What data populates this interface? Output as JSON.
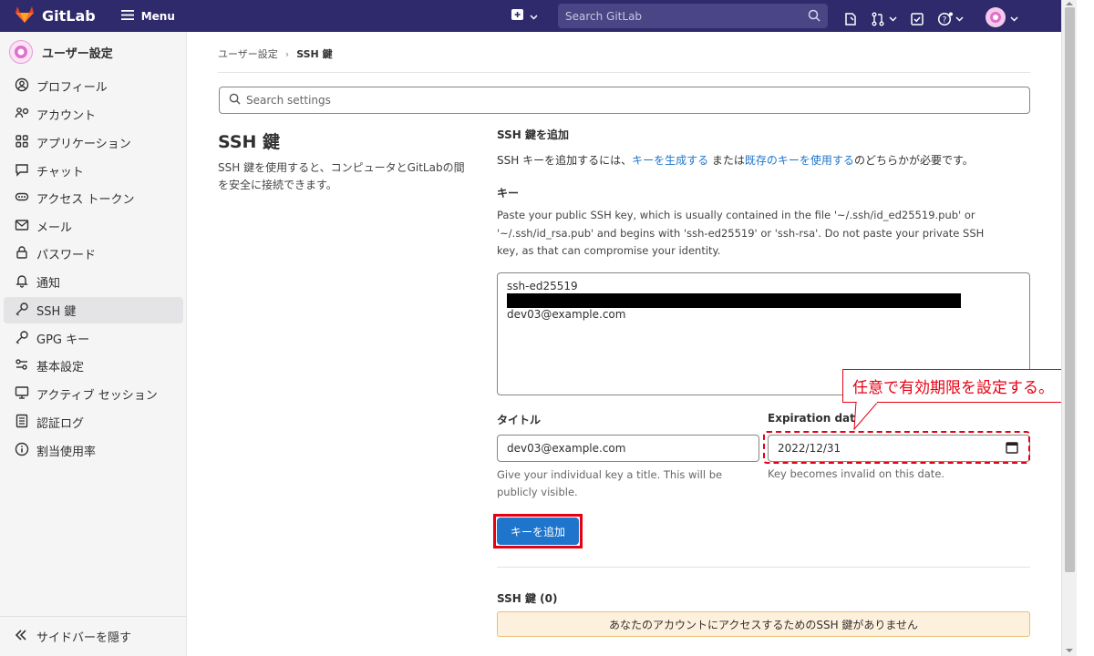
{
  "app": {
    "name": "GitLab",
    "menu_label": "Menu",
    "search_placeholder": "Search GitLab"
  },
  "sidebar": {
    "title": "ユーザー設定",
    "items": [
      {
        "label": "プロフィール",
        "icon": "profile-icon"
      },
      {
        "label": "アカウント",
        "icon": "account-icon"
      },
      {
        "label": "アプリケーション",
        "icon": "applications-icon"
      },
      {
        "label": "チャット",
        "icon": "chat-icon"
      },
      {
        "label": "アクセス トークン",
        "icon": "token-icon"
      },
      {
        "label": "メール",
        "icon": "mail-icon"
      },
      {
        "label": "パスワード",
        "icon": "lock-icon"
      },
      {
        "label": "通知",
        "icon": "bell-icon"
      },
      {
        "label": "SSH 鍵",
        "icon": "key-icon",
        "active": true
      },
      {
        "label": "GPG キー",
        "icon": "key-icon"
      },
      {
        "label": "基本設定",
        "icon": "preferences-icon"
      },
      {
        "label": "アクティブ セッション",
        "icon": "monitor-icon"
      },
      {
        "label": "認証ログ",
        "icon": "log-icon"
      },
      {
        "label": "割当使用率",
        "icon": "quota-icon"
      }
    ],
    "collapse_label": "サイドバーを隠す"
  },
  "breadcrumb": {
    "parent": "ユーザー設定",
    "current": "SSH 鍵"
  },
  "settings_search": {
    "placeholder": "Search settings"
  },
  "section": {
    "title": "SSH 鍵",
    "description": "SSH 鍵を使用すると、コンピュータとGitLabの間を安全に接続できます。"
  },
  "form": {
    "heading": "SSH 鍵を追加",
    "intro_prefix": "SSH キーを追加するには、",
    "intro_link1": "キーを生成する",
    "intro_mid": " または",
    "intro_link2": "既存のキーを使用する",
    "intro_suffix": "のどちらかが必要です。",
    "key_label": "キー",
    "key_help": "Paste your public SSH key, which is usually contained in the file '~/.ssh/id_ed25519.pub' or '~/.ssh/id_rsa.pub' and begins with 'ssh-ed25519' or 'ssh-rsa'. Do not paste your private SSH key, as that can compromise your identity.",
    "key_line1": "ssh-ed25519",
    "key_line3": "dev03@example.com",
    "title_label": "タイトル",
    "title_value": "dev03@example.com",
    "title_help": "Give your individual key a title. This will be publicly visible.",
    "expiration_label": "Expiration date",
    "expiration_value": "2022/12/31",
    "expiration_help": "Key becomes invalid on this date.",
    "submit_label": "キーを追加"
  },
  "keys_list": {
    "heading": "SSH 鍵 (0)",
    "empty_message": "あなたのアカウントにアクセスするためのSSH 鍵がありません"
  },
  "annotation": {
    "callout_text": "任意で有効期限を設定する。",
    "color": "#e50012"
  },
  "colors": {
    "navbar": "#2f2a6b",
    "primary_button": "#1f75cb",
    "link": "#1f75cb",
    "empty_alert_bg": "#fdf1dd"
  }
}
